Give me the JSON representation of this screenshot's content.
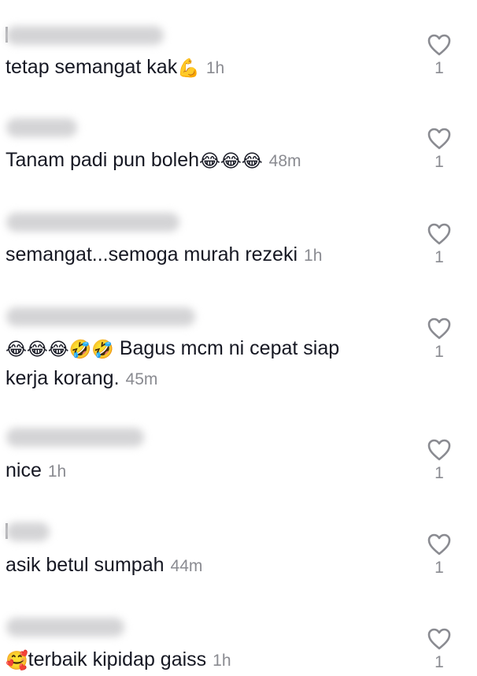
{
  "comments": [
    {
      "text": "tetap semangat kak",
      "emoji_after": "💪",
      "time": "1h",
      "likes": "1"
    },
    {
      "text": "Tanam padi pun boleh",
      "emoji_after": "😂😂😂",
      "time": "48m",
      "likes": "1"
    },
    {
      "text": "semangat...semoga murah rezeki",
      "time": "1h",
      "likes": "1"
    },
    {
      "emoji_before": "😂😂😂🤣🤣",
      "text": " Bagus mcm ni cepat siap kerja korang.",
      "time": "45m",
      "likes": "1"
    },
    {
      "text": "nice",
      "time": "1h",
      "likes": "1"
    },
    {
      "text": "asik betul sumpah",
      "time": "44m",
      "likes": "1"
    },
    {
      "emoji_before": "🥰",
      "text": "terbaik kipidap gaiss",
      "time": "1h",
      "likes": "1"
    }
  ],
  "icons": {
    "like": "heart-outline-icon"
  },
  "colors": {
    "text": "#161823",
    "muted": "#8a8b91",
    "blurred_username": "#d4d4d6"
  }
}
